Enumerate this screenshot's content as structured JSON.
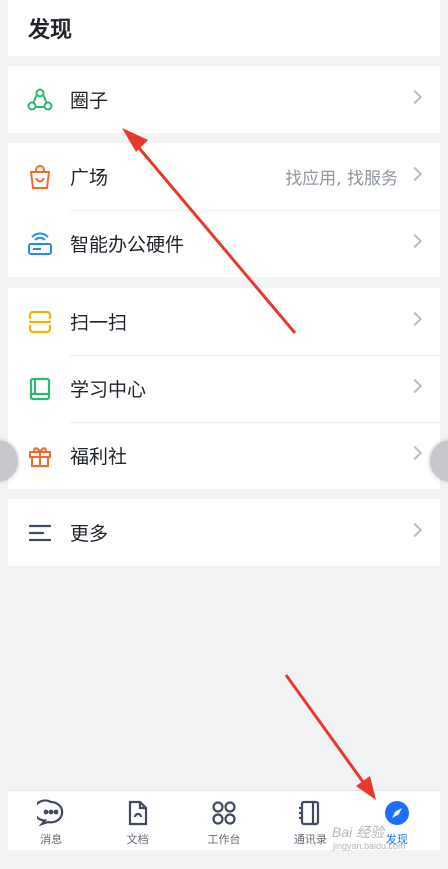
{
  "header": {
    "title": "发现"
  },
  "groups": [
    {
      "items": [
        {
          "label": "圈子",
          "icon": "circle-network-icon"
        }
      ]
    },
    {
      "items": [
        {
          "label": "广场",
          "hint": "找应用, 找服务",
          "icon": "shopping-bag-icon"
        },
        {
          "label": "智能办公硬件",
          "icon": "router-icon"
        }
      ]
    },
    {
      "items": [
        {
          "label": "扫一扫",
          "icon": "scan-icon"
        },
        {
          "label": "学习中心",
          "icon": "book-icon"
        },
        {
          "label": "福利社",
          "icon": "gift-icon"
        }
      ]
    },
    {
      "items": [
        {
          "label": "更多",
          "icon": "menu-lines-icon"
        }
      ]
    }
  ],
  "tabbar": {
    "tabs": [
      {
        "label": "消息",
        "icon": "message-icon"
      },
      {
        "label": "文档",
        "icon": "document-icon"
      },
      {
        "label": "工作台",
        "icon": "grid-icon"
      },
      {
        "label": "通讯录",
        "icon": "contacts-icon"
      },
      {
        "label": "发现",
        "icon": "compass-icon",
        "active": true
      }
    ]
  },
  "watermark": {
    "line1": "Bai 经验",
    "line2": "jingyan.baidu.com"
  },
  "colors": {
    "accent": "#1f6fff",
    "green": "#2bb673",
    "orange": "#f26b2b",
    "blue": "#1f8ef1",
    "yellow": "#f5b400",
    "arrow": "#e8392c"
  }
}
